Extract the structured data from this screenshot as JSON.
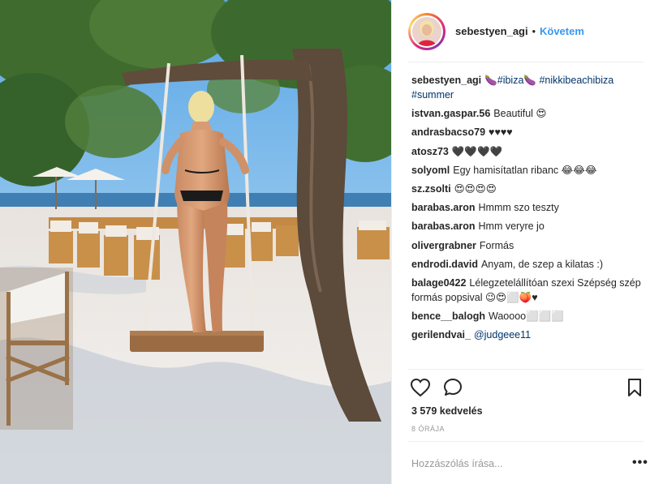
{
  "post": {
    "username": "sebestyen_agi",
    "separator": "•",
    "follow_label": "Követem"
  },
  "comments": [
    {
      "user": "sebestyen_agi",
      "text_parts": [
        {
          "text": "🍆",
          "tag": false
        },
        {
          "text": "#ibiza",
          "tag": true
        },
        {
          "text": "🍆 ",
          "tag": false
        },
        {
          "text": "#nikkibeachibiza #summer",
          "tag": true
        }
      ]
    },
    {
      "user": "istvan.gaspar.56",
      "text_parts": [
        {
          "text": "Beautiful 😍",
          "tag": false
        }
      ]
    },
    {
      "user": "andrasbacso79",
      "text_parts": [
        {
          "text": "♥♥♥♥",
          "tag": false
        }
      ]
    },
    {
      "user": "atosz73",
      "text_parts": [
        {
          "text": "🖤🖤🖤🖤",
          "tag": false
        }
      ]
    },
    {
      "user": "solyoml",
      "text_parts": [
        {
          "text": "Egy hamisítatlan ribanc 😂😂😂",
          "tag": false
        }
      ]
    },
    {
      "user": "sz.zsolti",
      "text_parts": [
        {
          "text": "😍😍😍😍",
          "tag": false
        }
      ]
    },
    {
      "user": "barabas.aron",
      "text_parts": [
        {
          "text": "Hmmm szo teszty",
          "tag": false
        }
      ]
    },
    {
      "user": "barabas.aron",
      "text_parts": [
        {
          "text": "Hmm veryre jo",
          "tag": false
        }
      ]
    },
    {
      "user": "olivergrabner",
      "text_parts": [
        {
          "text": "Formás",
          "tag": false
        }
      ]
    },
    {
      "user": "endrodi.david",
      "text_parts": [
        {
          "text": "Anyam, de szep a kilatas :)",
          "tag": false
        }
      ]
    },
    {
      "user": "balage0422",
      "text_parts": [
        {
          "text": "Lélegzetelállítóan szexi Szépség szép formás popsival 😉😍⬜🍑♥",
          "tag": false
        }
      ]
    },
    {
      "user": "bence__balogh",
      "text_parts": [
        {
          "text": "Waoooo⬜⬜⬜",
          "tag": false
        }
      ]
    },
    {
      "user": "gerilendvai_",
      "text_parts": [
        {
          "text": "@judgeee11",
          "tag": true
        }
      ]
    }
  ],
  "actions": {
    "like_icon": "heart-icon",
    "comment_icon": "speech-bubble-icon",
    "save_icon": "bookmark-icon"
  },
  "likes_text": "3 579 kedvelés",
  "time_text": "8 ÓRÁJA",
  "comment_input": {
    "placeholder": "Hozzászólás írása..."
  },
  "more_label": "•••",
  "colors": {
    "link": "#3897f0",
    "hashtag": "#003569",
    "text": "#262626",
    "muted": "#999999"
  }
}
